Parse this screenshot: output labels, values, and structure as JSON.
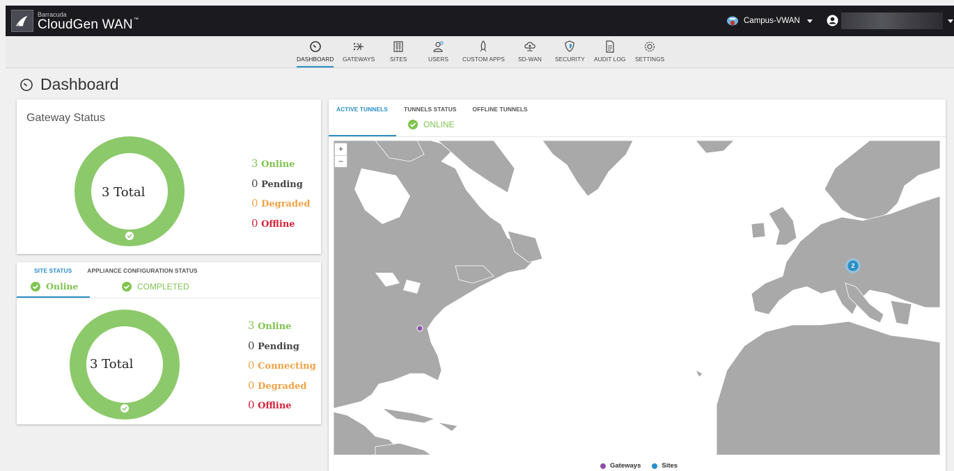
{
  "header": {
    "brand_small": "Barracuda",
    "brand_name": "CloudGen WAN",
    "brand_tm": "™",
    "workspace": "Campus-VWAN"
  },
  "nav": {
    "items": [
      {
        "label": "DASHBOARD",
        "icon": "speedometer-icon",
        "active": true
      },
      {
        "label": "GATEWAYS",
        "icon": "gateways-icon"
      },
      {
        "label": "SITES",
        "icon": "building-icon"
      },
      {
        "label": "USERS",
        "icon": "users-icon"
      },
      {
        "label": "CUSTOM APPS",
        "icon": "rocket-icon"
      },
      {
        "label": "SD-WAN",
        "icon": "cloud-network-icon"
      },
      {
        "label": "SECURITY",
        "icon": "shield-icon"
      },
      {
        "label": "AUDIT LOG",
        "icon": "document-icon"
      },
      {
        "label": "SETTINGS",
        "icon": "gear-icon"
      }
    ]
  },
  "page": {
    "title": "Dashboard"
  },
  "gateway_status": {
    "title": "Gateway Status",
    "total": "3 Total",
    "legend": [
      {
        "count": "3",
        "label": "Online"
      },
      {
        "count": "0",
        "label": "Pending"
      },
      {
        "count": "0",
        "label": "Degraded"
      },
      {
        "count": "0",
        "label": "Offline"
      }
    ]
  },
  "site_status": {
    "tabs": [
      "SITE STATUS",
      "APPLIANCE CONFIGURATION STATUS"
    ],
    "online_label": "Online",
    "completed_label": "COMPLETED",
    "total": "3 Total",
    "legend": [
      {
        "count": "3",
        "label": "Online"
      },
      {
        "count": "0",
        "label": "Pending"
      },
      {
        "count": "0",
        "label": "Connecting"
      },
      {
        "count": "0",
        "label": "Degraded"
      },
      {
        "count": "0",
        "label": "Offline"
      }
    ]
  },
  "tunnels": {
    "tabs": [
      "ACTIVE TUNNELS",
      "TUNNELS STATUS",
      "OFFLINE TUNNELS"
    ],
    "status": "ONLINE",
    "cluster_count": "2",
    "zoom_in": "+",
    "zoom_out": "−",
    "legend": [
      {
        "label": "Gateways",
        "color": "#8e4fa8"
      },
      {
        "label": "Sites",
        "color": "#2a8fc7"
      }
    ]
  },
  "colors": {
    "online": "#80c451",
    "degraded": "#f0a347",
    "offline": "#d8223a",
    "accent": "#2a8fc7"
  }
}
